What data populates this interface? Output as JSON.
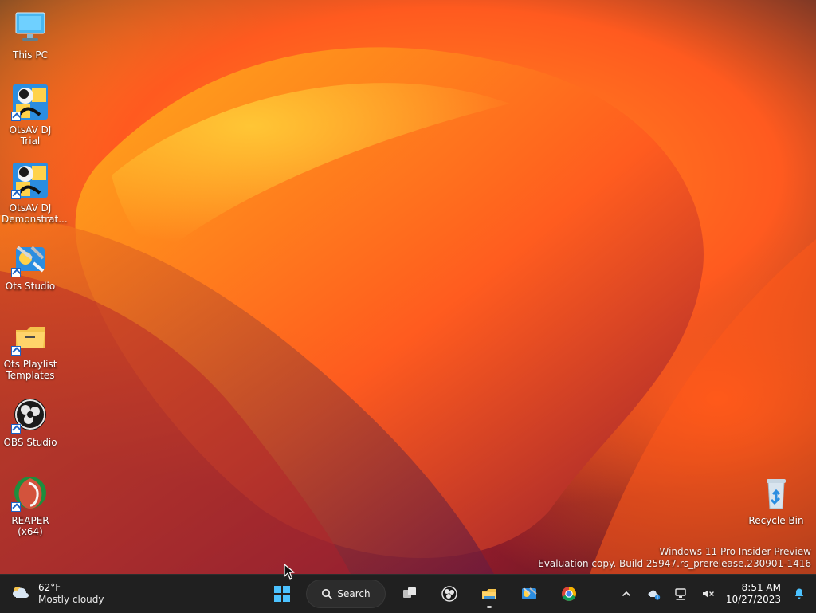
{
  "desktop": {
    "icons": [
      {
        "label": "This PC",
        "icon": "monitor-icon"
      },
      {
        "label": "OtsAV DJ Trial",
        "icon": "otsav-icon"
      },
      {
        "label": "OtsAV DJ Demonstrat...",
        "icon": "otsav-icon"
      },
      {
        "label": "Ots Studio",
        "icon": "ots-studio-icon"
      },
      {
        "label": "Ots Playlist Templates",
        "icon": "folder-icon"
      },
      {
        "label": "OBS Studio",
        "icon": "obs-icon"
      },
      {
        "label": "REAPER (x64)",
        "icon": "reaper-icon"
      },
      {
        "label": "Recycle Bin",
        "icon": "recycle-bin-icon"
      }
    ],
    "watermark": {
      "line1": "Windows 11 Pro Insider Preview",
      "line2": "Evaluation copy. Build 25947.rs_prerelease.230901-1416"
    }
  },
  "taskbar": {
    "weather": {
      "temp": "62°F",
      "desc": "Mostly cloudy",
      "icon": "cloud-sun-icon"
    },
    "search_label": "Search",
    "apps": [
      {
        "name": "start",
        "icon": "windows-logo-icon"
      },
      {
        "name": "task-view",
        "icon": "task-view-icon"
      },
      {
        "name": "obs",
        "icon": "obs-icon"
      },
      {
        "name": "file-explorer",
        "icon": "folder-icon",
        "active": true
      },
      {
        "name": "ots-studio",
        "icon": "ots-studio-icon"
      },
      {
        "name": "chrome",
        "icon": "chrome-icon"
      }
    ],
    "tray": {
      "time": "8:51 AM",
      "date": "10/27/2023"
    }
  },
  "colors": {
    "taskbar_bg": "#202020",
    "accent_blue": "#1e63c6"
  }
}
